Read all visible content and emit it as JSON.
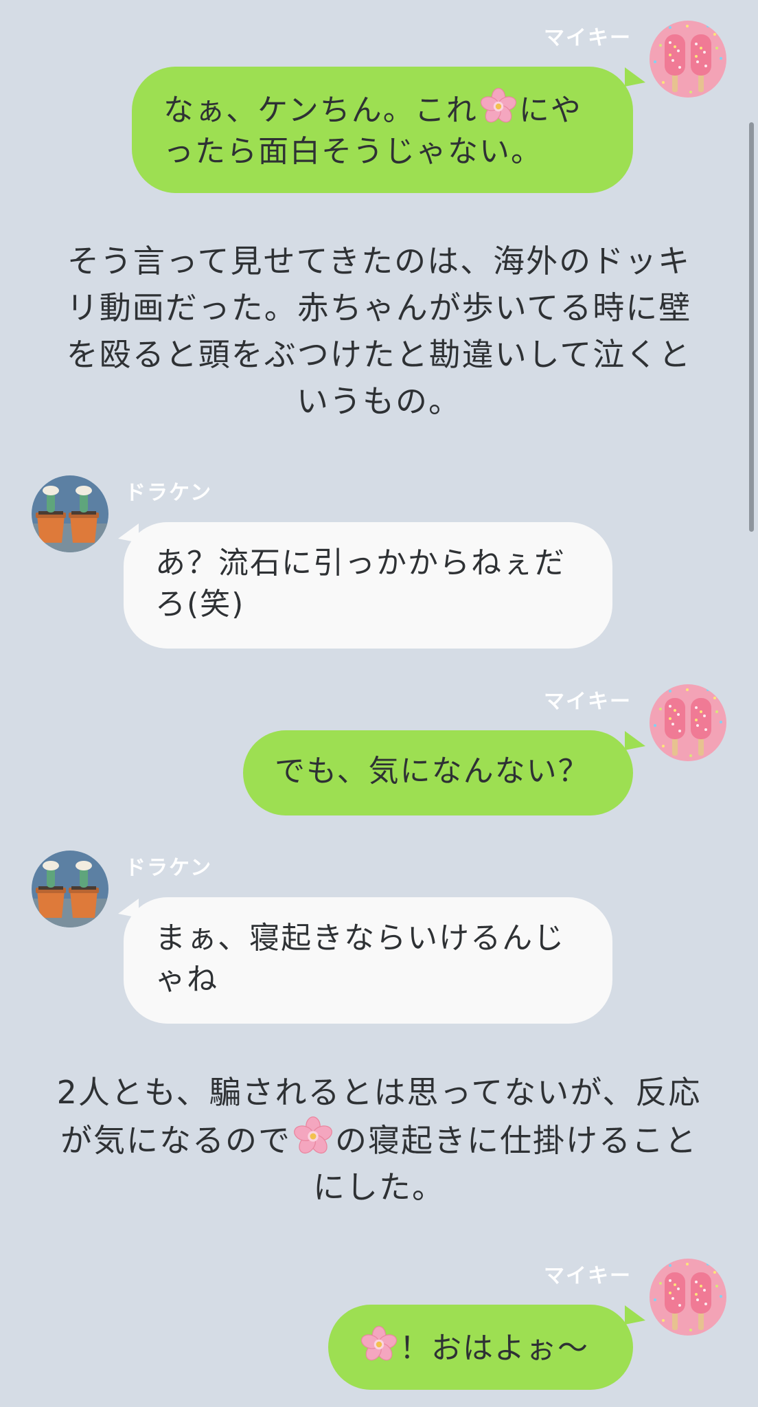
{
  "participants": {
    "mikey": {
      "name": "マイキー",
      "avatar_icon": "pink-popsicles-avatar-icon"
    },
    "draken": {
      "name": "ドラケン",
      "avatar_icon": "potted-cactus-avatar-icon"
    }
  },
  "messages": [
    {
      "sender": "マイキー",
      "before": "なぁ、ケンちん。これ",
      "emoji": "cherry-blossom-icon",
      "after": "にやったら面白そうじゃない。"
    },
    {
      "narration": "そう言って見せてきたのは、海外のドッキリ動画だった。赤ちゃんが歩いてる時に壁を殴ると頭をぶつけたと勘違いして泣くというもの。"
    },
    {
      "sender": "ドラケン",
      "text": "あ？流石に引っかからねぇだろ(笑)"
    },
    {
      "sender": "マイキー",
      "text": "でも、気になんない？"
    },
    {
      "sender": "ドラケン",
      "text": "まぁ、寝起きならいけるんじゃね"
    },
    {
      "narration_before": "2人とも、騙されるとは思ってないが、反応が気になるので",
      "emoji": "cherry-blossom-icon",
      "narration_after": "の寝起きに仕掛けることにした。"
    },
    {
      "sender": "マイキー",
      "emoji": "cherry-blossom-icon",
      "text": "！おはよぉ〜"
    }
  ],
  "colors": {
    "background": "#d5dce5",
    "outgoing_bubble": "#9ddf52",
    "incoming_bubble": "#f9f9f9",
    "text": "#2e3134",
    "sender_name": "#ffffff"
  }
}
